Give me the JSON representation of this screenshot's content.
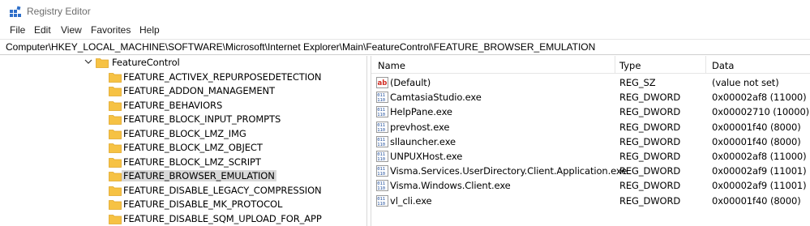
{
  "window": {
    "title": "Registry Editor"
  },
  "menu": [
    "File",
    "Edit",
    "View",
    "Favorites",
    "Help"
  ],
  "address": {
    "path": "Computer\\HKEY_LOCAL_MACHINE\\SOFTWARE\\Microsoft\\Internet Explorer\\Main\\FeatureControl\\FEATURE_BROWSER_EMULATION"
  },
  "tree": {
    "parent": {
      "label": "FeatureControl",
      "expanded": true
    },
    "children": [
      {
        "label": "FEATURE_ACTIVEX_REPURPOSEDETECTION",
        "selected": false
      },
      {
        "label": "FEATURE_ADDON_MANAGEMENT",
        "selected": false
      },
      {
        "label": "FEATURE_BEHAVIORS",
        "selected": false
      },
      {
        "label": "FEATURE_BLOCK_INPUT_PROMPTS",
        "selected": false
      },
      {
        "label": "FEATURE_BLOCK_LMZ_IMG",
        "selected": false
      },
      {
        "label": "FEATURE_BLOCK_LMZ_OBJECT",
        "selected": false
      },
      {
        "label": "FEATURE_BLOCK_LMZ_SCRIPT",
        "selected": false
      },
      {
        "label": "FEATURE_BROWSER_EMULATION",
        "selected": true
      },
      {
        "label": "FEATURE_DISABLE_LEGACY_COMPRESSION",
        "selected": false
      },
      {
        "label": "FEATURE_DISABLE_MK_PROTOCOL",
        "selected": false
      },
      {
        "label": "FEATURE_DISABLE_SQM_UPLOAD_FOR_APP",
        "selected": false
      }
    ]
  },
  "values": {
    "columns": {
      "name": "Name",
      "type": "Type",
      "data": "Data"
    },
    "rows": [
      {
        "icon": "string-value-icon",
        "name": "(Default)",
        "type": "REG_SZ",
        "data": "(value not set)"
      },
      {
        "icon": "binary-value-icon",
        "name": "CamtasiaStudio.exe",
        "type": "REG_DWORD",
        "data": "0x00002af8 (11000)"
      },
      {
        "icon": "binary-value-icon",
        "name": "HelpPane.exe",
        "type": "REG_DWORD",
        "data": "0x00002710 (10000)"
      },
      {
        "icon": "binary-value-icon",
        "name": "prevhost.exe",
        "type": "REG_DWORD",
        "data": "0x00001f40 (8000)"
      },
      {
        "icon": "binary-value-icon",
        "name": "sllauncher.exe",
        "type": "REG_DWORD",
        "data": "0x00001f40 (8000)"
      },
      {
        "icon": "binary-value-icon",
        "name": "UNPUXHost.exe",
        "type": "REG_DWORD",
        "data": "0x00002af8 (11000)"
      },
      {
        "icon": "binary-value-icon",
        "name": "Visma.Services.UserDirectory.Client.Application.exe",
        "type": "REG_DWORD",
        "data": "0x00002af9 (11001)"
      },
      {
        "icon": "binary-value-icon",
        "name": "Visma.Windows.Client.exe",
        "type": "REG_DWORD",
        "data": "0x00002af9 (11001)"
      },
      {
        "icon": "binary-value-icon",
        "name": "vl_cli.exe",
        "type": "REG_DWORD",
        "data": "0x00001f40 (8000)"
      }
    ]
  },
  "colors": {
    "folder": "#f6c244",
    "folder_dark": "#e0a526",
    "selection": "#d9d9d9",
    "icon_blue": "#1f4e9c",
    "icon_red": "#d02a20"
  }
}
